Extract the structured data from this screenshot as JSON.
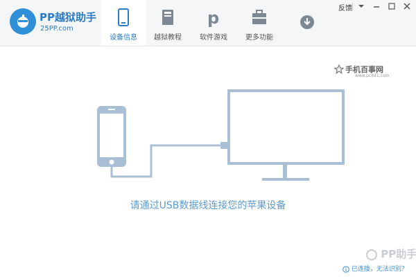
{
  "app": {
    "name": "PP越狱助手",
    "site": "25PP.com"
  },
  "tabs": [
    {
      "label": "设备信息",
      "icon": "phone-icon",
      "active": true
    },
    {
      "label": "越狱教程",
      "icon": "book-icon",
      "active": false
    },
    {
      "label": "软件游戏",
      "icon": "pp-store-icon",
      "active": false
    },
    {
      "label": "更多功能",
      "icon": "toolbox-icon",
      "active": false
    }
  ],
  "window": {
    "feedback_label": "反馈",
    "controls": [
      "menu-dropdown-icon",
      "minimize-icon",
      "maximize-icon",
      "close-icon"
    ]
  },
  "main": {
    "instruction": "请通过USB数据线连接您的苹果设备",
    "illustration": [
      "phone-outline-icon",
      "usb-cable-icon",
      "monitor-outline-icon"
    ]
  },
  "watermarks": {
    "top_title": "手机百事网",
    "top_url": "www.pc841.com",
    "bottom_brand": "PP助手"
  },
  "footer": {
    "link_text": "已连接，无法识别？"
  },
  "colors": {
    "accent": "#2a7cc7",
    "illustration": "#a9bfd6",
    "titlebar_bg": "#f5f6f8"
  }
}
